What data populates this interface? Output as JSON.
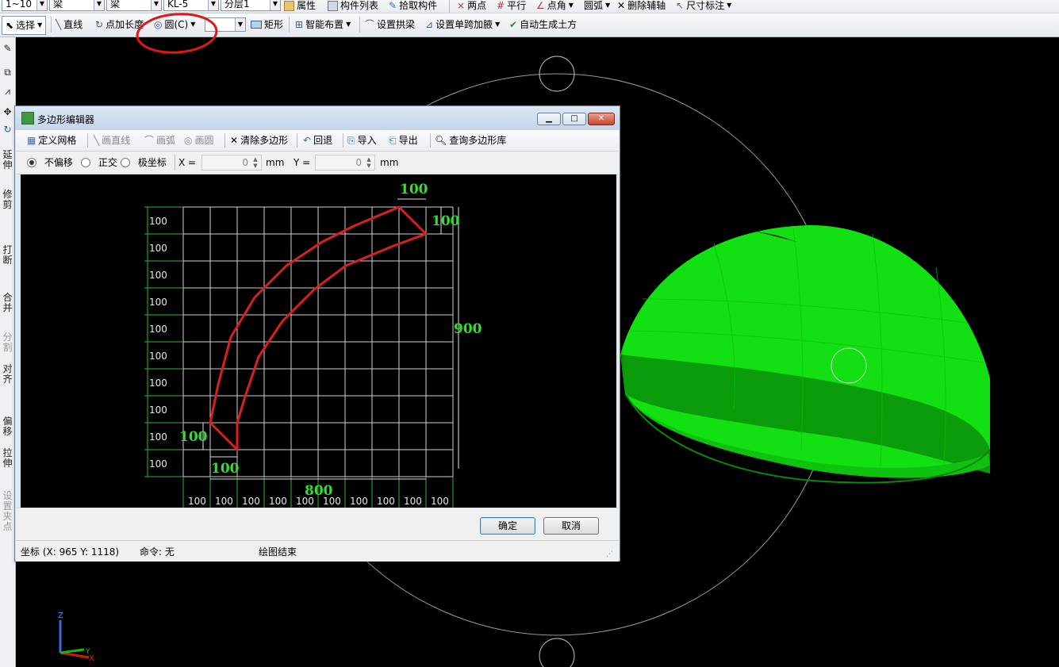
{
  "toolbar_top": {
    "combo1": "1~10",
    "combo2": "梁",
    "combo3": "梁",
    "combo4": "KL-5",
    "combo5": "分层1",
    "btn_props": "属性",
    "btn_list": "构件列表",
    "btn_pick": "拾取构件",
    "btn_twopoint": "两点",
    "btn_parallel": "平行",
    "btn_pointangle": "点角",
    "btn_arc": "圆弧",
    "btn_delaxis": "删除辅轴",
    "btn_dim": "尺寸标注"
  },
  "toolbar_draw": {
    "select": "选择",
    "line": "直线",
    "point_extend": "点加长度",
    "circle": "圆(C)",
    "rect": "矩形",
    "smart_layout": "智能布置",
    "set_arch_beam": "设置拱梁",
    "set_span_haunch": "设置单跨加腋",
    "auto_earthwork": "自动生成土方"
  },
  "left_tools": [
    {
      "label": "延伸",
      "enabled": true
    },
    {
      "label": "修剪",
      "enabled": true
    },
    {
      "label": "打断",
      "enabled": true
    },
    {
      "label": "合并",
      "enabled": true
    },
    {
      "label": "分割",
      "enabled": false
    },
    {
      "label": "对齐",
      "enabled": true
    },
    {
      "label": "偏移",
      "enabled": true
    },
    {
      "label": "拉伸",
      "enabled": true
    },
    {
      "label": "设置夹点",
      "enabled": false
    }
  ],
  "dialog": {
    "title": "多边形编辑器",
    "toolbar": {
      "define_grid": "定义网格",
      "draw_line": "画直线",
      "draw_arc": "画弧",
      "draw_circle": "画圆",
      "clear_polygon": "清除多边形",
      "undo": "回退",
      "import": "导入",
      "export": "导出",
      "query_library": "查询多边形库"
    },
    "options": {
      "no_offset": "不偏移",
      "ortho": "正交",
      "polar": "极坐标",
      "x_label": "X =",
      "x_value": "0",
      "x_unit": "mm",
      "y_label": "Y =",
      "y_value": "0",
      "y_unit": "mm",
      "selected": "no_offset"
    },
    "grid": {
      "row_labels": [
        "100",
        "100",
        "100",
        "100",
        "100",
        "100",
        "100",
        "100",
        "100",
        "100"
      ],
      "col_labels": [
        "100",
        "100",
        "100",
        "100",
        "100",
        "100",
        "100",
        "100",
        "100",
        "100"
      ],
      "dim_top": "100",
      "dim_right_small": "100",
      "dim_right_total": "900",
      "dim_left_small": "100",
      "dim_bottom_small": "100",
      "dim_bottom_total": "800"
    },
    "ok": "确定",
    "cancel": "取消",
    "status": {
      "coord": "坐标 (X: 965 Y: 1118)",
      "command": "命令: 无",
      "message": "绘图结束"
    }
  },
  "axes": {
    "z": "Z",
    "x": "X",
    "y": "Y"
  },
  "colors": {
    "dome_green": "#14e614",
    "grid_green": "#2db82d",
    "polygon_red": "#d92020",
    "annotation_red": "#e01818"
  }
}
